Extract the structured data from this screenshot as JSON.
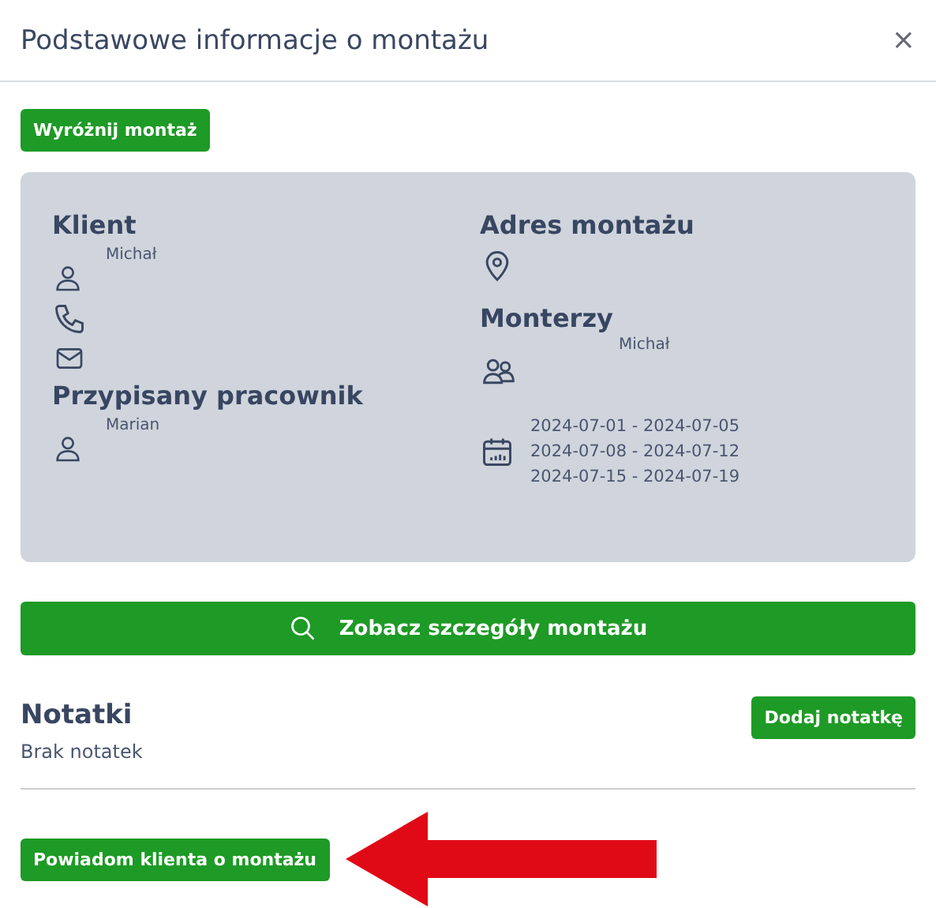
{
  "dialog": {
    "title": "Podstawowe informacje o montażu",
    "close": "×"
  },
  "highlight_button": "Wyróżnij montaż",
  "info_card": {
    "client": {
      "heading": "Klient",
      "name": "Michał"
    },
    "employee": {
      "heading": "Przypisany pracownik",
      "name": "Marian"
    },
    "address": {
      "heading": "Adres montażu"
    },
    "installers": {
      "heading": "Monterzy",
      "name": "Michał"
    },
    "dates": [
      "2024-07-01 - 2024-07-05",
      "2024-07-08 - 2024-07-12",
      "2024-07-15 - 2024-07-19"
    ]
  },
  "details_button": "Zobacz szczegóły montażu",
  "notes": {
    "heading": "Notatki",
    "add_button": "Dodaj notatkę",
    "empty_text": "Brak notatek"
  },
  "notify_button": "Powiadom klienta o montażu"
}
